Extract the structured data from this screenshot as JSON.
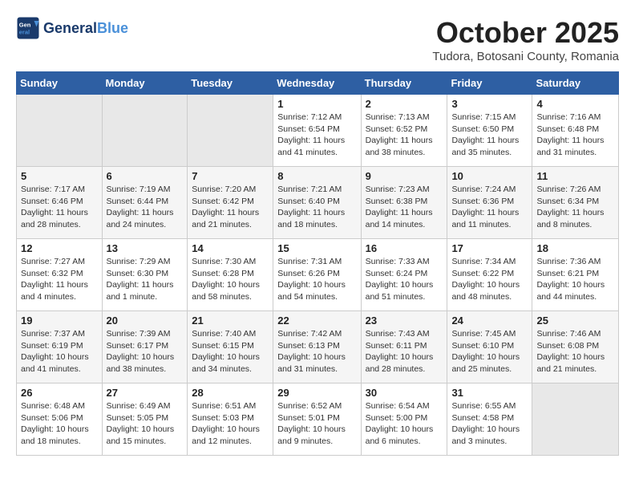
{
  "header": {
    "logo_line1": "General",
    "logo_line2": "Blue",
    "month": "October 2025",
    "location": "Tudora, Botosani County, Romania"
  },
  "days_of_week": [
    "Sunday",
    "Monday",
    "Tuesday",
    "Wednesday",
    "Thursday",
    "Friday",
    "Saturday"
  ],
  "weeks": [
    [
      {
        "day": "",
        "info": ""
      },
      {
        "day": "",
        "info": ""
      },
      {
        "day": "",
        "info": ""
      },
      {
        "day": "1",
        "info": "Sunrise: 7:12 AM\nSunset: 6:54 PM\nDaylight: 11 hours\nand 41 minutes."
      },
      {
        "day": "2",
        "info": "Sunrise: 7:13 AM\nSunset: 6:52 PM\nDaylight: 11 hours\nand 38 minutes."
      },
      {
        "day": "3",
        "info": "Sunrise: 7:15 AM\nSunset: 6:50 PM\nDaylight: 11 hours\nand 35 minutes."
      },
      {
        "day": "4",
        "info": "Sunrise: 7:16 AM\nSunset: 6:48 PM\nDaylight: 11 hours\nand 31 minutes."
      }
    ],
    [
      {
        "day": "5",
        "info": "Sunrise: 7:17 AM\nSunset: 6:46 PM\nDaylight: 11 hours\nand 28 minutes."
      },
      {
        "day": "6",
        "info": "Sunrise: 7:19 AM\nSunset: 6:44 PM\nDaylight: 11 hours\nand 24 minutes."
      },
      {
        "day": "7",
        "info": "Sunrise: 7:20 AM\nSunset: 6:42 PM\nDaylight: 11 hours\nand 21 minutes."
      },
      {
        "day": "8",
        "info": "Sunrise: 7:21 AM\nSunset: 6:40 PM\nDaylight: 11 hours\nand 18 minutes."
      },
      {
        "day": "9",
        "info": "Sunrise: 7:23 AM\nSunset: 6:38 PM\nDaylight: 11 hours\nand 14 minutes."
      },
      {
        "day": "10",
        "info": "Sunrise: 7:24 AM\nSunset: 6:36 PM\nDaylight: 11 hours\nand 11 minutes."
      },
      {
        "day": "11",
        "info": "Sunrise: 7:26 AM\nSunset: 6:34 PM\nDaylight: 11 hours\nand 8 minutes."
      }
    ],
    [
      {
        "day": "12",
        "info": "Sunrise: 7:27 AM\nSunset: 6:32 PM\nDaylight: 11 hours\nand 4 minutes."
      },
      {
        "day": "13",
        "info": "Sunrise: 7:29 AM\nSunset: 6:30 PM\nDaylight: 11 hours\nand 1 minute."
      },
      {
        "day": "14",
        "info": "Sunrise: 7:30 AM\nSunset: 6:28 PM\nDaylight: 10 hours\nand 58 minutes."
      },
      {
        "day": "15",
        "info": "Sunrise: 7:31 AM\nSunset: 6:26 PM\nDaylight: 10 hours\nand 54 minutes."
      },
      {
        "day": "16",
        "info": "Sunrise: 7:33 AM\nSunset: 6:24 PM\nDaylight: 10 hours\nand 51 minutes."
      },
      {
        "day": "17",
        "info": "Sunrise: 7:34 AM\nSunset: 6:22 PM\nDaylight: 10 hours\nand 48 minutes."
      },
      {
        "day": "18",
        "info": "Sunrise: 7:36 AM\nSunset: 6:21 PM\nDaylight: 10 hours\nand 44 minutes."
      }
    ],
    [
      {
        "day": "19",
        "info": "Sunrise: 7:37 AM\nSunset: 6:19 PM\nDaylight: 10 hours\nand 41 minutes."
      },
      {
        "day": "20",
        "info": "Sunrise: 7:39 AM\nSunset: 6:17 PM\nDaylight: 10 hours\nand 38 minutes."
      },
      {
        "day": "21",
        "info": "Sunrise: 7:40 AM\nSunset: 6:15 PM\nDaylight: 10 hours\nand 34 minutes."
      },
      {
        "day": "22",
        "info": "Sunrise: 7:42 AM\nSunset: 6:13 PM\nDaylight: 10 hours\nand 31 minutes."
      },
      {
        "day": "23",
        "info": "Sunrise: 7:43 AM\nSunset: 6:11 PM\nDaylight: 10 hours\nand 28 minutes."
      },
      {
        "day": "24",
        "info": "Sunrise: 7:45 AM\nSunset: 6:10 PM\nDaylight: 10 hours\nand 25 minutes."
      },
      {
        "day": "25",
        "info": "Sunrise: 7:46 AM\nSunset: 6:08 PM\nDaylight: 10 hours\nand 21 minutes."
      }
    ],
    [
      {
        "day": "26",
        "info": "Sunrise: 6:48 AM\nSunset: 5:06 PM\nDaylight: 10 hours\nand 18 minutes."
      },
      {
        "day": "27",
        "info": "Sunrise: 6:49 AM\nSunset: 5:05 PM\nDaylight: 10 hours\nand 15 minutes."
      },
      {
        "day": "28",
        "info": "Sunrise: 6:51 AM\nSunset: 5:03 PM\nDaylight: 10 hours\nand 12 minutes."
      },
      {
        "day": "29",
        "info": "Sunrise: 6:52 AM\nSunset: 5:01 PM\nDaylight: 10 hours\nand 9 minutes."
      },
      {
        "day": "30",
        "info": "Sunrise: 6:54 AM\nSunset: 5:00 PM\nDaylight: 10 hours\nand 6 minutes."
      },
      {
        "day": "31",
        "info": "Sunrise: 6:55 AM\nSunset: 4:58 PM\nDaylight: 10 hours\nand 3 minutes."
      },
      {
        "day": "",
        "info": ""
      }
    ]
  ]
}
